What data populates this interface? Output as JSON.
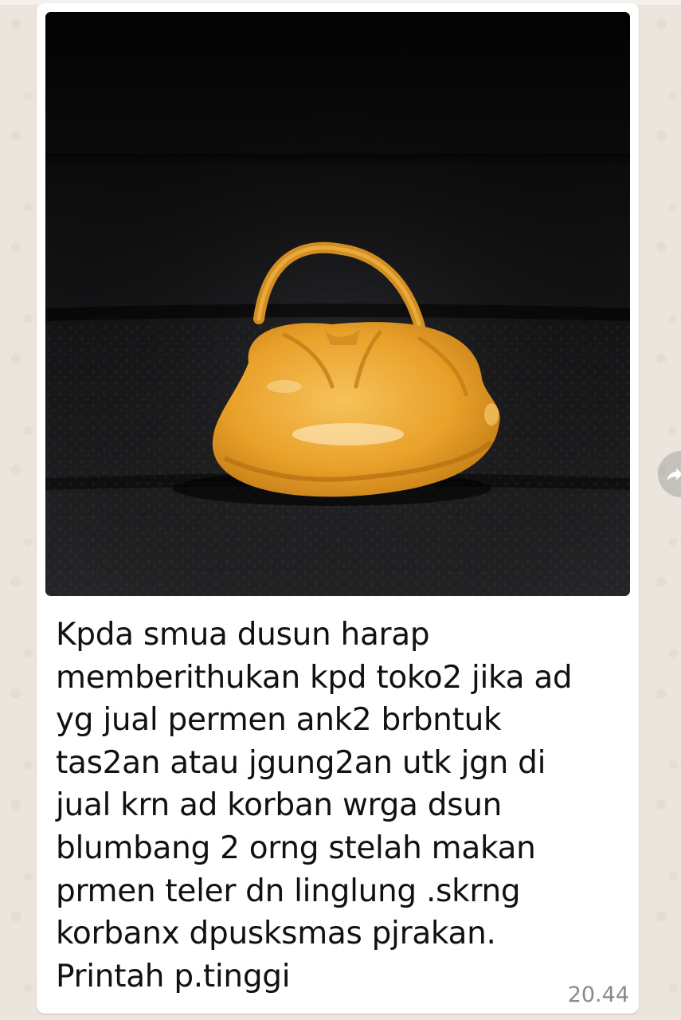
{
  "message": {
    "image_alt": "photo of an orange handbag-shaped candy",
    "caption": "Kpda smua dusun harap\nmemberithukan kpd toko2 jika ad\nyg jual permen ank2 brbntuk\ntas2an atau jgung2an utk jgn di\njual krn ad korban wrga dsun\nblumbang 2 orng stelah makan\nprmen teler dn linglung .skrng\nkorbanx dpusksmas pjrakan.\nPrintah p.tinggi",
    "time": "20.44"
  },
  "icons": {
    "forward": "forward-arrow-icon"
  },
  "colors": {
    "chat_background": "#ece5dd",
    "bubble": "#ffffff",
    "candy": "#e9a12a",
    "timestamp": "#8a8a8a"
  }
}
